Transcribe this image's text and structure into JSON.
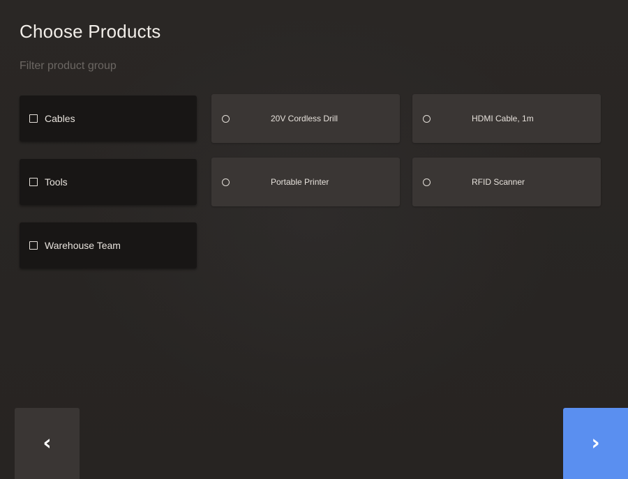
{
  "header": {
    "title": "Choose Products",
    "subtitle": "Filter product group"
  },
  "groups": [
    {
      "label": "Cables",
      "checked": false
    },
    {
      "label": "Tools",
      "checked": false
    },
    {
      "label": "Warehouse Team",
      "checked": false
    }
  ],
  "products": [
    {
      "label": "20V Cordless Drill",
      "selected": false
    },
    {
      "label": "HDMI Cable, 1m",
      "selected": false
    },
    {
      "label": "Portable Printer",
      "selected": false
    },
    {
      "label": "RFID Scanner",
      "selected": false
    }
  ],
  "navigation": {
    "back_icon": "chevron-left-icon",
    "next_icon": "chevron-right-icon",
    "back_glyph": "‹",
    "next_glyph": "›",
    "next_color": "#5a8ff0"
  }
}
